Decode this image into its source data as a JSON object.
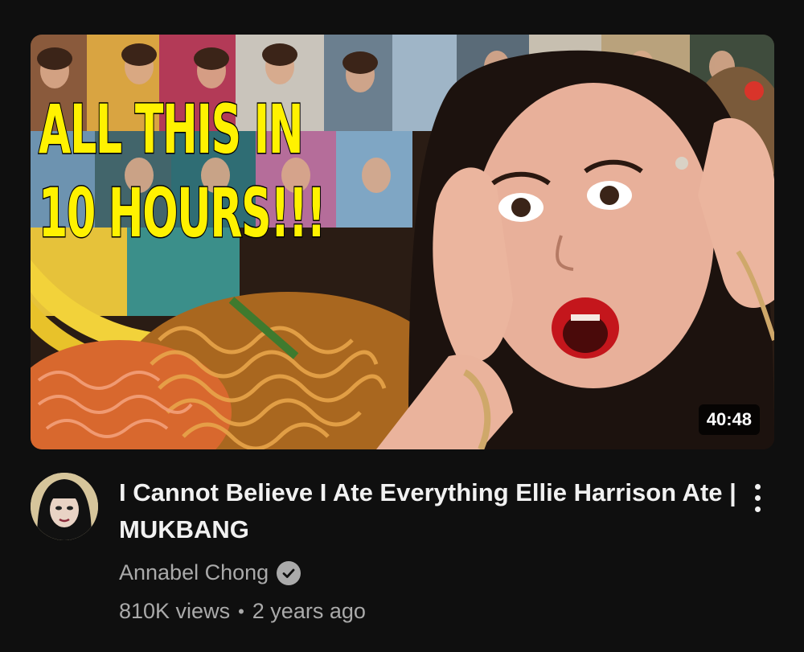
{
  "thumbnail": {
    "headline_line1": "ALL THIS IN",
    "headline_line2": "10 HOURS!!!",
    "duration": "40:48"
  },
  "video": {
    "title": "I Cannot Believe I Ate Everything Ellie Harrison Ate | MUKBANG",
    "channel": "Annabel Chong",
    "views": "810K views",
    "separator": "•",
    "age": "2 years ago"
  },
  "icons": {
    "verified": "check-circle-icon",
    "more": "three-dot-vertical-icon",
    "avatar": "channel-avatar"
  },
  "colors": {
    "background": "#0f0f0f",
    "title_text": "#f1f1f1",
    "secondary_text": "#aaaaaa",
    "headline_fill": "#fff200"
  }
}
